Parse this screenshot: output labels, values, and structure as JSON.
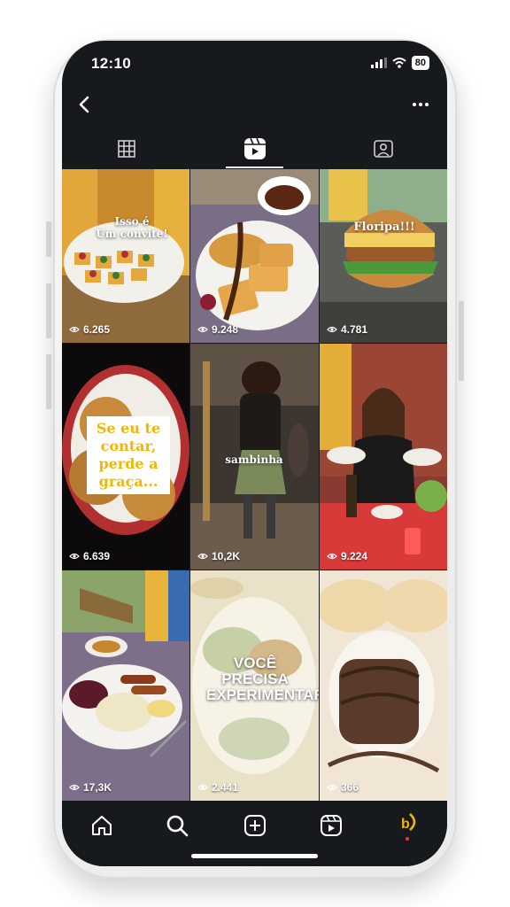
{
  "status_bar": {
    "time": "12:10",
    "battery": "80"
  },
  "tabs": [
    {
      "name": "grid",
      "icon": "grid-icon",
      "active": false
    },
    {
      "name": "reels",
      "icon": "reels-icon",
      "active": true
    },
    {
      "name": "tagged",
      "icon": "tagged-icon",
      "active": false
    }
  ],
  "reels": [
    {
      "overlay": "Isso é\nUm convite!",
      "views": "6.265"
    },
    {
      "overlay": "",
      "views": "9.248"
    },
    {
      "overlay": "Floripa!!!",
      "views": "4.781"
    },
    {
      "overlay": "Se eu te\ncontar,\nperde a\ngraça...",
      "views": "6.639"
    },
    {
      "overlay": "sambinha",
      "views": "10,2K"
    },
    {
      "overlay": "",
      "views": "9.224"
    },
    {
      "overlay": "",
      "views": "17,3K"
    },
    {
      "overlay": "VOCÊ\nPRECISA\nEXPERIMENTAR!",
      "views": "2.441"
    },
    {
      "overlay": "",
      "views": "366"
    }
  ],
  "bottom_nav": [
    "home-icon",
    "search-icon",
    "create-icon",
    "reels-icon",
    "profile-avatar"
  ],
  "colors": {
    "background": "#161a1d",
    "accent": "#f2b705",
    "notification_dot": "#ff3040"
  }
}
